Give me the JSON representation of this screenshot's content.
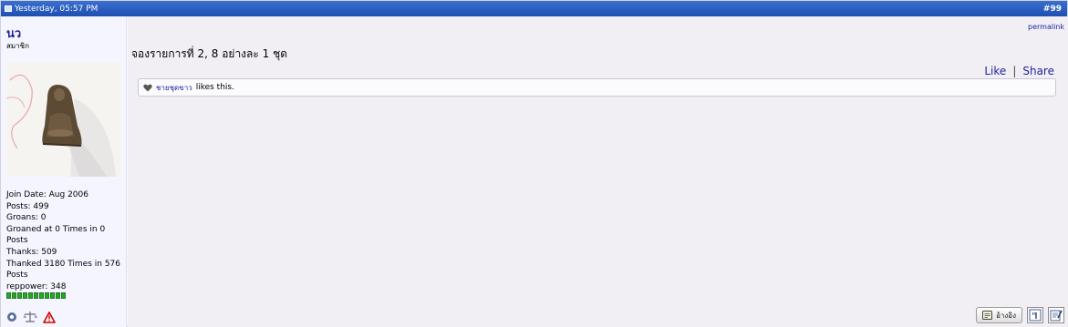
{
  "header": {
    "date": "Yesterday, 05:57 PM",
    "post_number": "#99"
  },
  "user": {
    "name": "นว",
    "title": "สมาชิก",
    "stats": [
      "Join Date: Aug 2006",
      "Posts: 499",
      "Groans: 0",
      "Groaned at 0 Times in 0 Posts",
      "Thanks: 509",
      "Thanked 3180 Times in 576 Posts",
      "reppower: 348"
    ],
    "rep_segments": 11
  },
  "post": {
    "permalink": "permalink",
    "message": "จองรายการที่ 2, 8 อย่างละ 1 ชุด",
    "like_label": "Like",
    "share_label": "Share",
    "liker": "ชายชุดขาว",
    "likes_text": "likes this."
  },
  "buttons": {
    "quote_label": "อ้างอิง"
  },
  "icons": {
    "post": "post-icon",
    "online": "offline-status-icon",
    "reputation": "reputation-scale-icon",
    "report": "report-warning-icon",
    "heart": "heart-icon",
    "multiquote": "multiquote-icon",
    "quickreply": "quick-reply-icon"
  },
  "colors": {
    "header_bg": "#2a5bbf",
    "link": "#22229c",
    "rep_green": "#2aa52a",
    "report_red": "#cc0000"
  }
}
